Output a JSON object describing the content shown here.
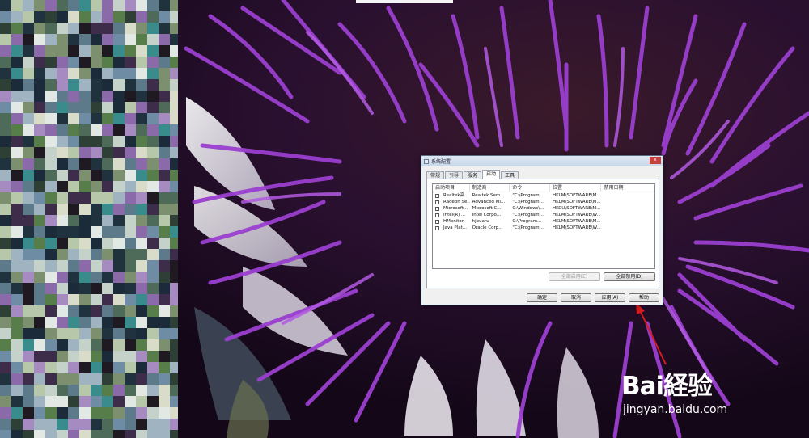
{
  "window": {
    "title": "系统配置",
    "close_glyph": "x"
  },
  "tabs": [
    {
      "label": "常规",
      "active": false
    },
    {
      "label": "引导",
      "active": false
    },
    {
      "label": "服务",
      "active": false
    },
    {
      "label": "启动",
      "active": true
    },
    {
      "label": "工具",
      "active": false
    }
  ],
  "startup_list": {
    "columns": [
      "启动项目",
      "制造商",
      "命令",
      "位置",
      "禁用日期"
    ],
    "rows": [
      {
        "checked": true,
        "item": "Realtek高...",
        "manufacturer": "Realtek Sem...",
        "command": "\"C:\\Program...",
        "location": "HKLM\\SOFTWARE\\M...",
        "disabled_date": ""
      },
      {
        "checked": true,
        "item": "Radeon Se...",
        "manufacturer": "Advanced Mi...",
        "command": "\"C:\\Program...",
        "location": "HKLM\\SOFTWARE\\M...",
        "disabled_date": ""
      },
      {
        "checked": true,
        "item": "Microsoft...",
        "manufacturer": "Microsoft C...",
        "command": "C:\\Windows\\...",
        "location": "HKCU\\SOFTWARE\\M...",
        "disabled_date": ""
      },
      {
        "checked": true,
        "item": "Intel(R) ...",
        "manufacturer": "Intel Corpo...",
        "command": "\"C:\\Program...",
        "location": "HKLM\\SOFTWARE\\W...",
        "disabled_date": ""
      },
      {
        "checked": true,
        "item": "HMonitor",
        "manufacturer": "hjbuaru",
        "command": "C:\\Program...",
        "location": "HKLM\\SOFTWARE\\M...",
        "disabled_date": ""
      },
      {
        "checked": true,
        "item": "Java Plat...",
        "manufacturer": "Oracle Corp...",
        "command": "\"C:\\Program...",
        "location": "HKLM\\SOFTWARE\\W...",
        "disabled_date": ""
      }
    ],
    "check_glyph": "✓"
  },
  "buttons": {
    "enable_all": "全部启用(E)",
    "disable_all": "全部禁用(D)",
    "ok": "确定",
    "cancel": "取消",
    "apply": "应用(A)",
    "help": "帮助"
  },
  "watermark": {
    "logo_text": "Bai経验",
    "url": "jingyan.baidu.com"
  },
  "colors": {
    "arrow": "#d61c1c",
    "petal": "#9b3fd0",
    "titlebar": "#c8d6e7"
  }
}
